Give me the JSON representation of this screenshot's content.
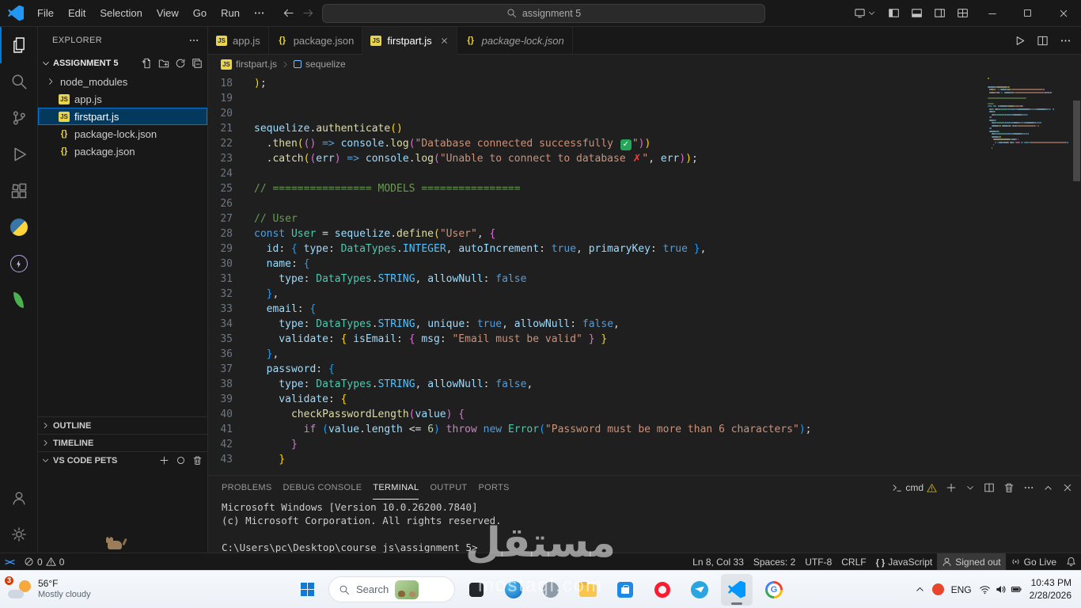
{
  "title_bar": {
    "menus": [
      "File",
      "Edit",
      "Selection",
      "View",
      "Go",
      "Run"
    ],
    "search_text": "assignment 5"
  },
  "activity_bar": {
    "top": [
      {
        "name": "explorer",
        "active": true
      },
      {
        "name": "search",
        "active": false
      },
      {
        "name": "source-control",
        "active": false
      },
      {
        "name": "run-debug",
        "active": false
      },
      {
        "name": "extensions",
        "active": false
      },
      {
        "name": "python",
        "active": false
      },
      {
        "name": "thunder-client",
        "active": false
      },
      {
        "name": "mongodb",
        "active": false
      }
    ],
    "bottom": [
      {
        "name": "account",
        "active": false
      },
      {
        "name": "settings",
        "active": false
      }
    ]
  },
  "explorer": {
    "title": "EXPLORER",
    "project": "ASSIGNMENT 5",
    "files": [
      {
        "label": "node_modules",
        "icon": "folder",
        "selected": false
      },
      {
        "label": "app.js",
        "icon": "js",
        "selected": false
      },
      {
        "label": "firstpart.js",
        "icon": "js",
        "selected": true
      },
      {
        "label": "package-lock.json",
        "icon": "json",
        "selected": false
      },
      {
        "label": "package.json",
        "icon": "json",
        "selected": false
      }
    ],
    "sections": [
      {
        "label": "OUTLINE",
        "collapsed": true,
        "actions": false
      },
      {
        "label": "TIMELINE",
        "collapsed": true,
        "actions": false
      },
      {
        "label": "VS CODE PETS",
        "collapsed": false,
        "actions": true
      }
    ]
  },
  "editor": {
    "tabs": [
      {
        "label": "app.js",
        "icon": "js",
        "active": false,
        "italic": false
      },
      {
        "label": "package.json",
        "icon": "json",
        "active": false,
        "italic": false
      },
      {
        "label": "firstpart.js",
        "icon": "js",
        "active": true,
        "italic": false
      },
      {
        "label": "package-lock.json",
        "icon": "json",
        "active": false,
        "italic": true
      }
    ],
    "breadcrumb": [
      {
        "label": "firstpart.js",
        "icon": "js"
      },
      {
        "label": "sequelize",
        "icon": "symbol"
      }
    ],
    "code": {
      "palette": {
        "pun": "#d4d4d4",
        "kw": "#569cd6",
        "ctrl": "#c586c0",
        "fn": "#dcdcaa",
        "str": "#ce9178",
        "cmt": "#6a9955",
        "var": "#9cdcfe",
        "cls": "#4ec9b0",
        "cst": "#4fc1ff",
        "num": "#b5cea8",
        "b1": "#ffd700",
        "b2": "#da70d6",
        "b3": "#179fff"
      },
      "lines": [
        {
          "n": 18,
          "t": [
            [
              ")",
              "b1"
            ],
            [
              ";",
              "pun"
            ]
          ]
        },
        {
          "n": 19,
          "t": []
        },
        {
          "n": 20,
          "t": []
        },
        {
          "n": 21,
          "t": [
            [
              "sequelize",
              "var"
            ],
            [
              ".",
              "pun"
            ],
            [
              "authenticate",
              "fn"
            ],
            [
              "()",
              "b1"
            ]
          ]
        },
        {
          "n": 22,
          "t": [
            [
              "  .",
              "pun"
            ],
            [
              "then",
              "fn"
            ],
            [
              "(",
              "b1"
            ],
            [
              "()",
              "b2"
            ],
            [
              " ",
              "pun"
            ],
            [
              "=>",
              "kw"
            ],
            [
              " ",
              "pun"
            ],
            [
              "console",
              "var"
            ],
            [
              ".",
              "pun"
            ],
            [
              "log",
              "fn"
            ],
            [
              "(",
              "b2"
            ],
            [
              "\"Database connected successfully ✅\"",
              "str"
            ],
            [
              ")",
              "b2"
            ],
            [
              ")",
              "b1"
            ]
          ]
        },
        {
          "n": 23,
          "t": [
            [
              "  .",
              "pun"
            ],
            [
              "catch",
              "fn"
            ],
            [
              "(",
              "b1"
            ],
            [
              "(",
              "b2"
            ],
            [
              "err",
              "var"
            ],
            [
              ")",
              "b2"
            ],
            [
              " ",
              "pun"
            ],
            [
              "=>",
              "kw"
            ],
            [
              " ",
              "pun"
            ],
            [
              "console",
              "var"
            ],
            [
              ".",
              "pun"
            ],
            [
              "log",
              "fn"
            ],
            [
              "(",
              "b2"
            ],
            [
              "\"Unable to connect to database ❌\"",
              "str"
            ],
            [
              ", ",
              "pun"
            ],
            [
              "err",
              "var"
            ],
            [
              ")",
              "b2"
            ],
            [
              ")",
              "b1"
            ],
            [
              ";",
              "pun"
            ]
          ]
        },
        {
          "n": 24,
          "t": []
        },
        {
          "n": 25,
          "t": [
            [
              "// ================ MODELS ================",
              "cmt"
            ]
          ]
        },
        {
          "n": 26,
          "t": []
        },
        {
          "n": 27,
          "t": [
            [
              "// User",
              "cmt"
            ]
          ]
        },
        {
          "n": 28,
          "t": [
            [
              "const",
              "kw"
            ],
            [
              " ",
              "pun"
            ],
            [
              "User",
              "cls"
            ],
            [
              " = ",
              "pun"
            ],
            [
              "sequelize",
              "var"
            ],
            [
              ".",
              "pun"
            ],
            [
              "define",
              "fn"
            ],
            [
              "(",
              "b1"
            ],
            [
              "\"User\"",
              "str"
            ],
            [
              ", ",
              "pun"
            ],
            [
              "{",
              "b2"
            ]
          ]
        },
        {
          "n": 29,
          "t": [
            [
              "  id",
              "var"
            ],
            [
              ": ",
              "pun"
            ],
            [
              "{",
              "b3"
            ],
            [
              " type",
              "var"
            ],
            [
              ": ",
              "pun"
            ],
            [
              "DataTypes",
              "cls"
            ],
            [
              ".",
              "pun"
            ],
            [
              "INTEGER",
              "cst"
            ],
            [
              ", ",
              "pun"
            ],
            [
              "autoIncrement",
              "var"
            ],
            [
              ": ",
              "pun"
            ],
            [
              "true",
              "kw"
            ],
            [
              ", ",
              "pun"
            ],
            [
              "primaryKey",
              "var"
            ],
            [
              ": ",
              "pun"
            ],
            [
              "true",
              "kw"
            ],
            [
              " ",
              "pun"
            ],
            [
              "}",
              "b3"
            ],
            [
              ",",
              "pun"
            ]
          ]
        },
        {
          "n": 30,
          "t": [
            [
              "  name",
              "var"
            ],
            [
              ": ",
              "pun"
            ],
            [
              "{",
              "b3"
            ]
          ]
        },
        {
          "n": 31,
          "t": [
            [
              "    type",
              "var"
            ],
            [
              ": ",
              "pun"
            ],
            [
              "DataTypes",
              "cls"
            ],
            [
              ".",
              "pun"
            ],
            [
              "STRING",
              "cst"
            ],
            [
              ", ",
              "pun"
            ],
            [
              "allowNull",
              "var"
            ],
            [
              ": ",
              "pun"
            ],
            [
              "false",
              "kw"
            ]
          ]
        },
        {
          "n": 32,
          "t": [
            [
              "  ",
              "pun"
            ],
            [
              "}",
              "b3"
            ],
            [
              ",",
              "pun"
            ]
          ]
        },
        {
          "n": 33,
          "t": [
            [
              "  email",
              "var"
            ],
            [
              ": ",
              "pun"
            ],
            [
              "{",
              "b3"
            ]
          ]
        },
        {
          "n": 34,
          "t": [
            [
              "    type",
              "var"
            ],
            [
              ": ",
              "pun"
            ],
            [
              "DataTypes",
              "cls"
            ],
            [
              ".",
              "pun"
            ],
            [
              "STRING",
              "cst"
            ],
            [
              ", ",
              "pun"
            ],
            [
              "unique",
              "var"
            ],
            [
              ": ",
              "pun"
            ],
            [
              "true",
              "kw"
            ],
            [
              ", ",
              "pun"
            ],
            [
              "allowNull",
              "var"
            ],
            [
              ": ",
              "pun"
            ],
            [
              "false",
              "kw"
            ],
            [
              ",",
              "pun"
            ]
          ]
        },
        {
          "n": 35,
          "t": [
            [
              "    validate",
              "var"
            ],
            [
              ": ",
              "pun"
            ],
            [
              "{",
              "b1"
            ],
            [
              " isEmail",
              "var"
            ],
            [
              ": ",
              "pun"
            ],
            [
              "{",
              "b2"
            ],
            [
              " msg",
              "var"
            ],
            [
              ": ",
              "pun"
            ],
            [
              "\"Email must be valid\"",
              "str"
            ],
            [
              " ",
              "pun"
            ],
            [
              "}",
              "b2"
            ],
            [
              " ",
              "pun"
            ],
            [
              "}",
              "b1"
            ]
          ]
        },
        {
          "n": 36,
          "t": [
            [
              "  ",
              "pun"
            ],
            [
              "}",
              "b3"
            ],
            [
              ",",
              "pun"
            ]
          ]
        },
        {
          "n": 37,
          "t": [
            [
              "  password",
              "var"
            ],
            [
              ": ",
              "pun"
            ],
            [
              "{",
              "b3"
            ]
          ]
        },
        {
          "n": 38,
          "t": [
            [
              "    type",
              "var"
            ],
            [
              ": ",
              "pun"
            ],
            [
              "DataTypes",
              "cls"
            ],
            [
              ".",
              "pun"
            ],
            [
              "STRING",
              "cst"
            ],
            [
              ", ",
              "pun"
            ],
            [
              "allowNull",
              "var"
            ],
            [
              ": ",
              "pun"
            ],
            [
              "false",
              "kw"
            ],
            [
              ",",
              "pun"
            ]
          ]
        },
        {
          "n": 39,
          "t": [
            [
              "    validate",
              "var"
            ],
            [
              ": ",
              "pun"
            ],
            [
              "{",
              "b1"
            ]
          ]
        },
        {
          "n": 40,
          "t": [
            [
              "      checkPasswordLength",
              "fn"
            ],
            [
              "(",
              "b2"
            ],
            [
              "value",
              "var"
            ],
            [
              ")",
              "b2"
            ],
            [
              " ",
              "pun"
            ],
            [
              "{",
              "b2"
            ]
          ]
        },
        {
          "n": 41,
          "t": [
            [
              "        ",
              "pun"
            ],
            [
              "if",
              "ctrl"
            ],
            [
              " ",
              "pun"
            ],
            [
              "(",
              "b3"
            ],
            [
              "value",
              "var"
            ],
            [
              ".",
              "pun"
            ],
            [
              "length",
              "var"
            ],
            [
              " <= ",
              "pun"
            ],
            [
              "6",
              "num"
            ],
            [
              ")",
              "b3"
            ],
            [
              " ",
              "pun"
            ],
            [
              "throw",
              "ctrl"
            ],
            [
              " ",
              "pun"
            ],
            [
              "new",
              "kw"
            ],
            [
              " ",
              "pun"
            ],
            [
              "Error",
              "cls"
            ],
            [
              "(",
              "b3"
            ],
            [
              "\"Password must be more than 6 characters\"",
              "str"
            ],
            [
              ")",
              "b3"
            ],
            [
              ";",
              "pun"
            ]
          ]
        },
        {
          "n": 42,
          "t": [
            [
              "      ",
              "pun"
            ],
            [
              "}",
              "b2"
            ]
          ]
        },
        {
          "n": 43,
          "t": [
            [
              "    ",
              "pun"
            ],
            [
              "}",
              "b1"
            ]
          ]
        }
      ]
    }
  },
  "terminal": {
    "tabs": [
      "PROBLEMS",
      "DEBUG CONSOLE",
      "TERMINAL",
      "OUTPUT",
      "PORTS"
    ],
    "active_tab": "TERMINAL",
    "shell": "cmd",
    "lines": [
      "Microsoft Windows [Version 10.0.26200.7840]",
      "(c) Microsoft Corporation. All rights reserved.",
      "",
      "C:\\Users\\pc\\Desktop\\course_js\\assignment 5>"
    ]
  },
  "status_bar": {
    "errors": "0",
    "warnings": "0",
    "right": [
      {
        "name": "cursor-position",
        "label": "Ln 8, Col 33",
        "icon": "",
        "highlight": false
      },
      {
        "name": "indentation",
        "label": "Spaces: 2",
        "icon": "",
        "highlight": false
      },
      {
        "name": "encoding",
        "label": "UTF-8",
        "icon": "",
        "highlight": false
      },
      {
        "name": "eol",
        "label": "CRLF",
        "icon": "",
        "highlight": false
      },
      {
        "name": "language-mode",
        "label": "JavaScript",
        "icon": "braces",
        "highlight": false
      },
      {
        "name": "signed-out",
        "label": "Signed out",
        "icon": "account",
        "highlight": true
      },
      {
        "name": "go-live",
        "label": "Go Live",
        "icon": "broadcast",
        "highlight": false
      },
      {
        "name": "notifications",
        "label": "",
        "icon": "bell",
        "highlight": false
      }
    ]
  },
  "taskbar": {
    "weather": {
      "badge": "3",
      "temp": "56°F",
      "condition": "Mostly cloudy"
    },
    "search_label": "Search",
    "apps": [
      {
        "name": "dark-app",
        "active": false
      },
      {
        "name": "edge",
        "active": false
      },
      {
        "name": "gray-app",
        "active": false
      },
      {
        "name": "file-explorer",
        "active": false
      },
      {
        "name": "microsoft-store",
        "active": false
      },
      {
        "name": "opera",
        "active": false
      },
      {
        "name": "telegram",
        "active": false
      },
      {
        "name": "vscode",
        "active": true
      },
      {
        "name": "chrome",
        "active": false
      }
    ],
    "tray": {
      "language": "ENG",
      "time": "10:43 PM",
      "date": "2/28/2026"
    }
  },
  "watermark": {
    "text": "مستقل",
    "subtext": "mostaql.com"
  }
}
